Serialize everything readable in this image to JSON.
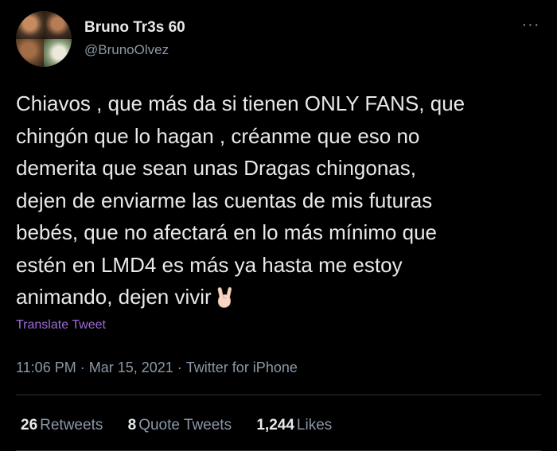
{
  "user": {
    "display_name": "Bruno Tr3s 60",
    "handle": "@BrunoOlvez"
  },
  "more_icon": "more-horizontal-icon",
  "tweet": {
    "lines": [
      "Chiavos , que más da si tienen ONLY FANS, que",
      "chingón que lo hagan , créanme que eso no",
      "demerita que sean unas Dragas chingonas,",
      "dejen de enviarme las cuentas de mis futuras",
      "bebés, que no afectará en lo más mínimo que",
      "estén en LMD4 es más ya hasta me estoy",
      "animando, dejen vivir"
    ],
    "emoji": "sign-of-the-horns-emoji",
    "translate_label": "Translate Tweet"
  },
  "meta": {
    "time": "11:06 PM",
    "separator": "·",
    "date": "Mar 15, 2021",
    "source": "Twitter for iPhone"
  },
  "stats": {
    "retweets": {
      "count": "26",
      "label": "Retweets"
    },
    "quote_tweets": {
      "count": "8",
      "label": "Quote Tweets"
    },
    "likes": {
      "count": "1,244",
      "label": "Likes"
    }
  },
  "colors": {
    "background": "#000000",
    "text": "#e7e9ea",
    "secondary": "#8b98a5",
    "link": "#9b6bd6",
    "divider": "#2f3336"
  }
}
